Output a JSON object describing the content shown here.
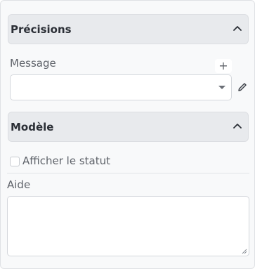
{
  "precisions": {
    "title": "Précisions",
    "message_label": "Message",
    "add_label": "+",
    "message_value": ""
  },
  "modele": {
    "title": "Modèle",
    "show_status_label": "Afficher le statut",
    "show_status_checked": false
  },
  "aide": {
    "label": "Aide",
    "value": ""
  },
  "icons": {
    "collapse": "chevron-up-icon",
    "dropdown": "caret-down-icon",
    "edit": "pencil-icon",
    "add": "plus-icon"
  }
}
